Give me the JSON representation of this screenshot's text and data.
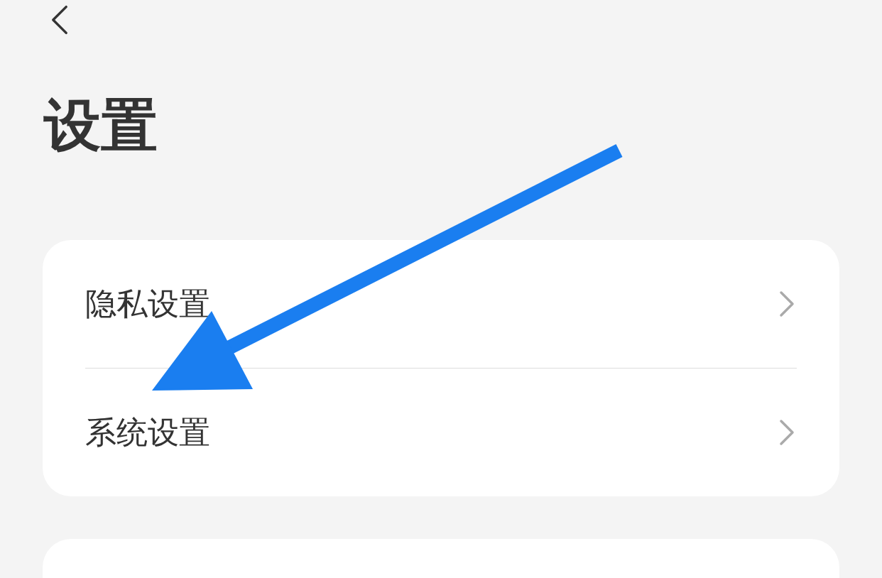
{
  "header": {
    "title": "设置"
  },
  "settings_group": [
    {
      "label": "隐私设置"
    },
    {
      "label": "系统设置"
    }
  ]
}
